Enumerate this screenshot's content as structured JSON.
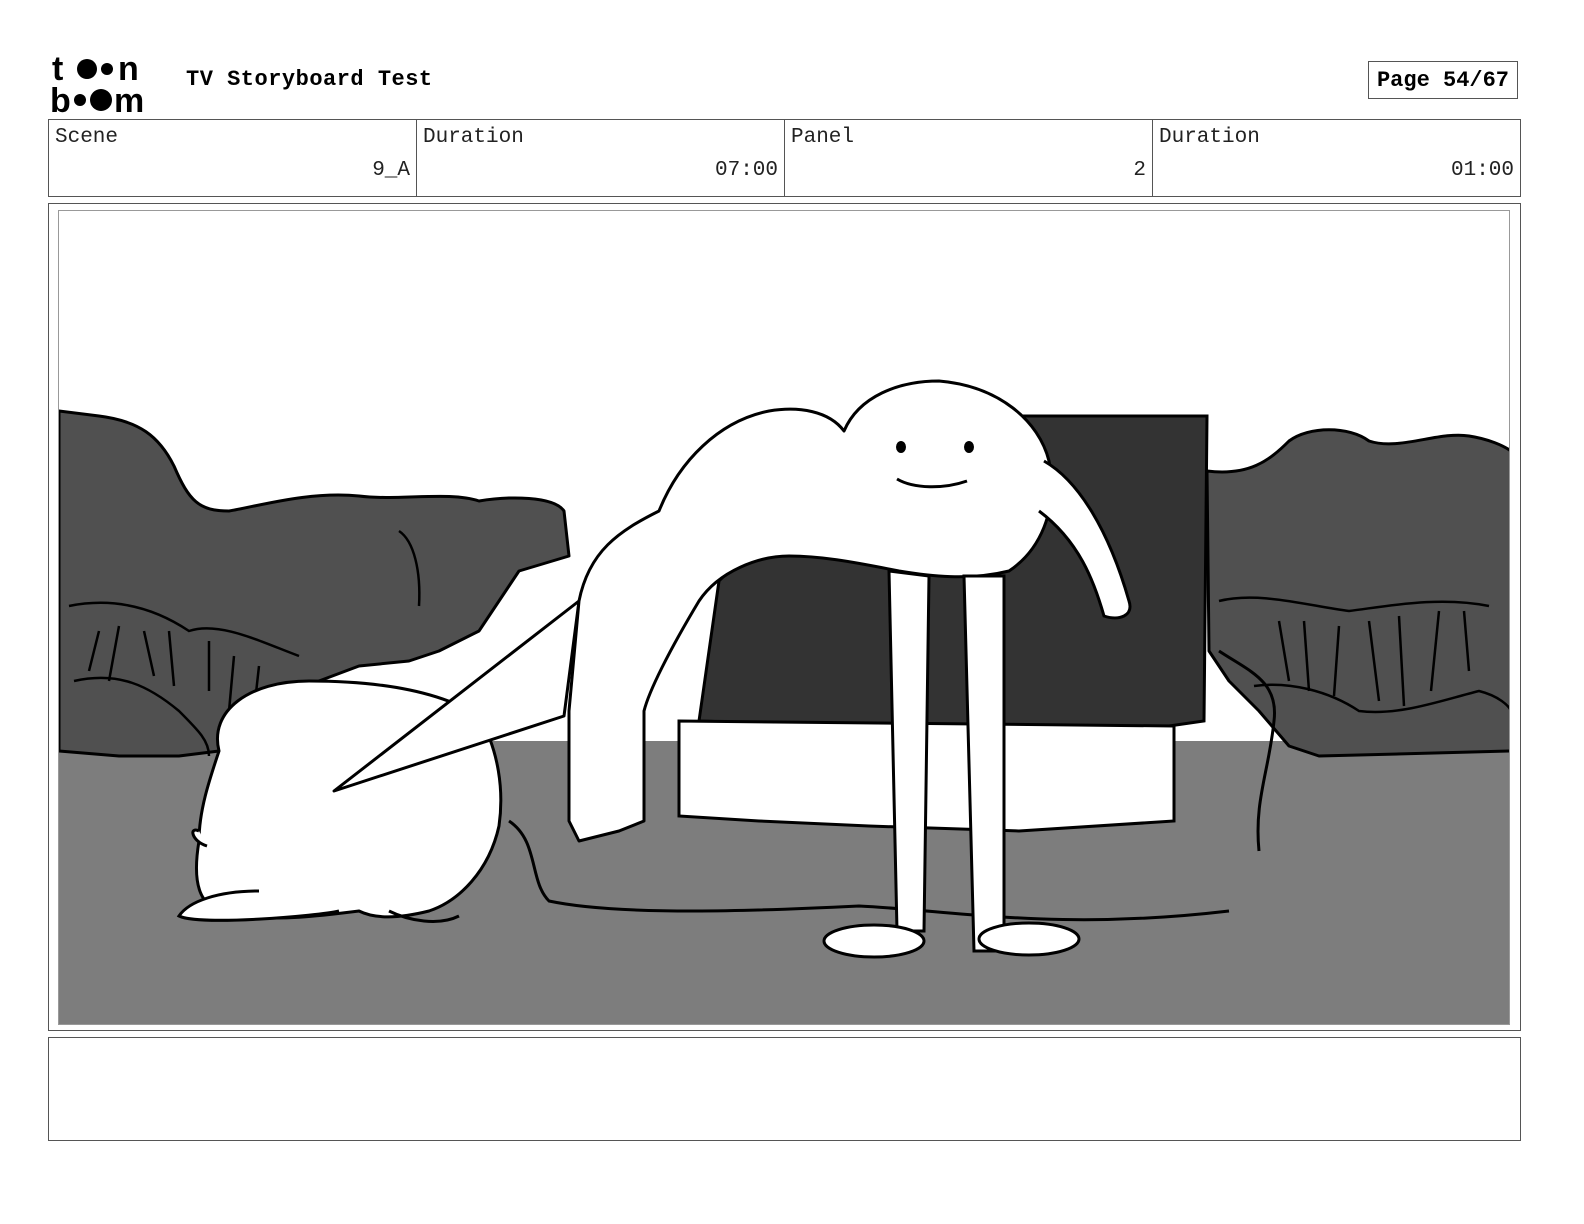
{
  "header": {
    "logo_text": "toon boom",
    "title": "TV Storyboard Test",
    "page_label": "Page 54/67"
  },
  "info": [
    {
      "label": "Scene",
      "value": "9_A"
    },
    {
      "label": "Duration",
      "value": "07:00"
    },
    {
      "label": "Panel",
      "value": "2"
    },
    {
      "label": "Duration",
      "value": "01:00"
    }
  ],
  "notes": {
    "text": ""
  }
}
